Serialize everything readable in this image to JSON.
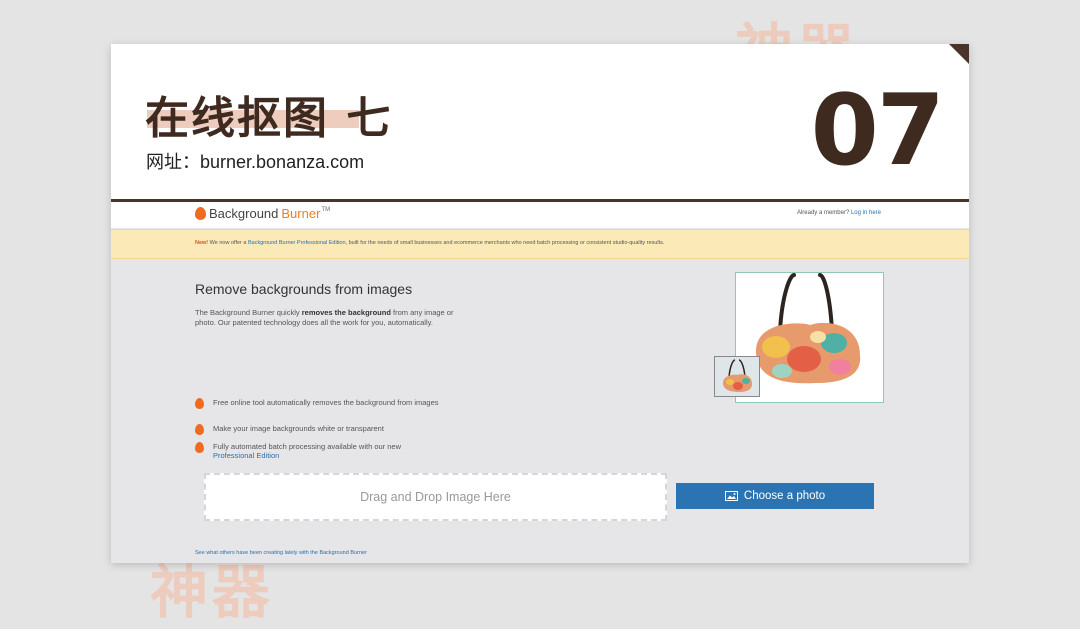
{
  "background_text": {
    "top": "神器",
    "bottom": "神器"
  },
  "slide": {
    "title": "在线抠图 七",
    "url_label": "网址：burner.bonanza.com",
    "number": "07"
  },
  "site": {
    "logo": {
      "part1": "Background",
      "part2": "Burner",
      "tm": "TM"
    },
    "member_prompt": "Already a member?",
    "login_link": "Log in here",
    "banner": {
      "new": "New!",
      "text1": " We now offer a ",
      "link": "Background Burner Professional Edition",
      "text2": ", built for the needs of small businesses and ecommerce merchants who need batch processing or consistent studio-quality results."
    },
    "heading": "Remove backgrounds from images",
    "desc_part1": "The Background Burner quickly ",
    "desc_bold": "removes the background",
    "desc_part2": " from any image or photo. Our patented technology does all the work for you, automatically.",
    "features": [
      {
        "text": "Free online tool automatically removes the background from images"
      },
      {
        "text": "Make your image backgrounds white or transparent"
      },
      {
        "text": "Fully automated batch processing available with our new",
        "link": "Professional Edition"
      }
    ],
    "dropzone_text": "Drag and Drop Image Here",
    "choose_button": "Choose a photo",
    "footer_link": "See what others have been creating lately with the Background Burner"
  },
  "colors": {
    "accent_brown": "#3f2a20",
    "accent_orange": "#ef7e22",
    "button_blue": "#2a74b3",
    "banner_yellow": "#fbe9b8"
  }
}
